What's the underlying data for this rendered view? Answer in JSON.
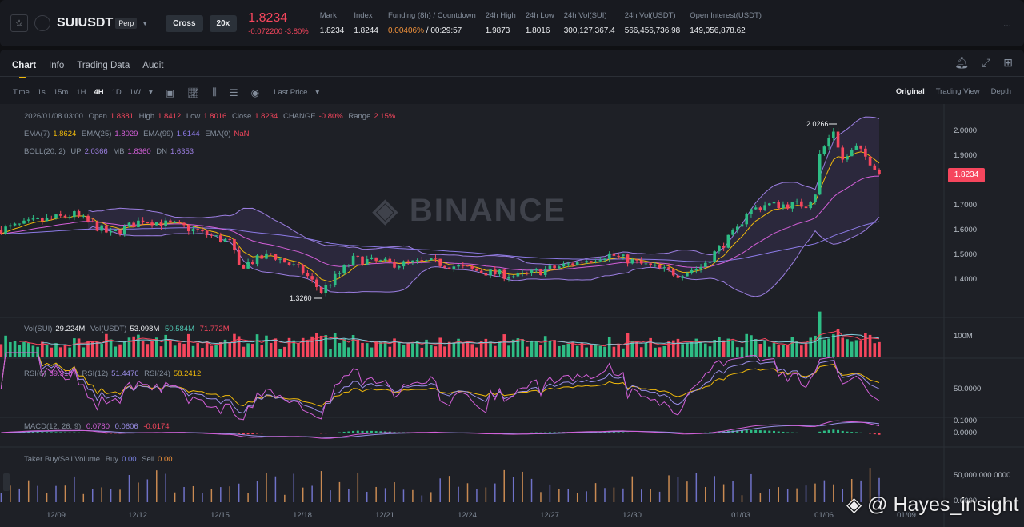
{
  "header": {
    "symbol": "SUIUSDT",
    "contract_type": "Perp",
    "margin_mode": "Cross",
    "leverage": "20x",
    "last_price": "1.8234",
    "change": "-0.072200 -3.80%",
    "stats": [
      {
        "label": "Mark",
        "value": "1.8234"
      },
      {
        "label": "Index",
        "value": "1.8244"
      },
      {
        "label": "Funding (8h) / Countdown",
        "value": "0.00406%",
        "value2": "/ 00:29:57"
      },
      {
        "label": "24h High",
        "value": "1.9873"
      },
      {
        "label": "24h Low",
        "value": "1.8016"
      },
      {
        "label": "24h Vol(SUI)",
        "value": "300,127,367.4"
      },
      {
        "label": "24h Vol(USDT)",
        "value": "566,456,736.98"
      },
      {
        "label": "Open Interest(USDT)",
        "value": "149,056,878.62"
      }
    ],
    "more": "..."
  },
  "tabs": [
    "Chart",
    "Info",
    "Trading Data",
    "Audit"
  ],
  "toolbar": {
    "intervals": [
      "Time",
      "1s",
      "15m",
      "1H",
      "4H",
      "1D",
      "1W"
    ],
    "active": "4H",
    "price_type": "Last Price",
    "views": [
      "Original",
      "Trading View",
      "Depth"
    ]
  },
  "legend": {
    "ohlc": {
      "date": "2026/01/08 03:00",
      "open_l": "Open",
      "open": "1.8381",
      "high_l": "High",
      "high": "1.8412",
      "low_l": "Low",
      "low": "1.8016",
      "close_l": "Close",
      "close": "1.8234",
      "change_l": "CHANGE",
      "change": "-0.80%",
      "range_l": "Range",
      "range": "2.15%"
    },
    "ema": [
      {
        "label": "EMA(7)",
        "value": "1.8624",
        "color": "#f0b90b"
      },
      {
        "label": "EMA(25)",
        "value": "1.8029",
        "color": "#d35fd8"
      },
      {
        "label": "EMA(99)",
        "value": "1.6144",
        "color": "#8c7ae6"
      },
      {
        "label": "EMA(0)",
        "value": "NaN",
        "color": "#f6465d"
      }
    ],
    "boll": {
      "label": "BOLL(20, 2)",
      "up_l": "UP",
      "up": "2.0366",
      "mb_l": "MB",
      "mb": "1.8360",
      "dn_l": "DN",
      "dn": "1.6353"
    },
    "vol": {
      "label": "Vol(SUI)",
      "value": "29.224M",
      "label2": "Vol(USDT)",
      "value2": "53.098M",
      "ma1": "50.584M",
      "ma2": "71.772M"
    },
    "rsi": [
      {
        "label": "RSI(6)",
        "value": "39.3187"
      },
      {
        "label": "RSI(12)",
        "value": "51.4476"
      },
      {
        "label": "RSI(24)",
        "value": "58.2412"
      }
    ],
    "macd": {
      "label": "MACD(12, 26, 9)",
      "dif": "0.0780",
      "dea": "0.0606",
      "hist": "-0.0174"
    },
    "taker": {
      "label": "Taker Buy/Sell Volume",
      "buy_l": "Buy",
      "buy": "0.00",
      "sell_l": "Sell",
      "sell": "0.00"
    }
  },
  "chart_data": {
    "type": "candlestick",
    "interval": "4H",
    "price_ticks": [
      "2.0000",
      "1.9000",
      "1.7000",
      "1.6000",
      "1.5000",
      "1.4000"
    ],
    "current_price": "1.8234",
    "max_label": "2.0266",
    "min_label": "1.3260",
    "vol_ticks": [
      "100M"
    ],
    "rsi_ticks": [
      "50.0000"
    ],
    "macd_ticks": [
      "0.1000",
      "0.0000"
    ],
    "taker_ticks": [
      "50,000,000.0000",
      "0.0000"
    ],
    "x_ticks": [
      "12/09",
      "12/12",
      "12/15",
      "12/18",
      "12/21",
      "12/24",
      "12/27",
      "12/30",
      "01/03",
      "01/06",
      "01/09"
    ],
    "close_path": [
      [
        "2025-12-07T00:00",
        1.6
      ],
      [
        "2025-12-08T04:00",
        1.63
      ],
      [
        "2025-12-09T16:00",
        1.66
      ],
      [
        "2025-12-11T00:00",
        1.58
      ],
      [
        "2025-12-12T04:00",
        1.64
      ],
      [
        "2025-12-13T16:00",
        1.61
      ],
      [
        "2025-12-15T08:00",
        1.55
      ],
      [
        "2025-12-15T16:00",
        1.45
      ],
      [
        "2025-12-16T20:00",
        1.5
      ],
      [
        "2025-12-18T00:00",
        1.43
      ],
      [
        "2025-12-18T16:00",
        1.35
      ],
      [
        "2025-12-19T20:00",
        1.48
      ],
      [
        "2025-12-21T12:00",
        1.46
      ],
      [
        "2025-12-22T16:00",
        1.47
      ],
      [
        "2025-12-24T12:00",
        1.43
      ],
      [
        "2025-12-25T20:00",
        1.41
      ],
      [
        "2025-12-27T08:00",
        1.45
      ],
      [
        "2025-12-29T04:00",
        1.5
      ],
      [
        "2025-12-30T08:00",
        1.46
      ],
      [
        "2025-12-31T16:00",
        1.42
      ],
      [
        "2026-01-01T12:00",
        1.45
      ],
      [
        "2026-01-02T20:00",
        1.6
      ],
      [
        "2026-01-03T04:00",
        1.67
      ],
      [
        "2026-01-03T20:00",
        1.7
      ],
      [
        "2026-01-05T08:00",
        1.7
      ],
      [
        "2026-01-05T16:00",
        1.75
      ],
      [
        "2026-01-05T20:00",
        1.9
      ],
      [
        "2026-01-06T08:00",
        2.0
      ],
      [
        "2026-01-06T16:00",
        1.88
      ],
      [
        "2026-01-07T04:00",
        1.93
      ],
      [
        "2026-01-08T03:00",
        1.8234
      ]
    ],
    "colors": {
      "up": "#2ebd85",
      "down": "#f6465d",
      "ema7": "#f0b90b",
      "ema25": "#d35fd8",
      "ema99": "#8c7ae6",
      "boll": "#9b7ee0"
    }
  },
  "watermark": "BINANCE",
  "overlay": "@ Hayes_insight"
}
